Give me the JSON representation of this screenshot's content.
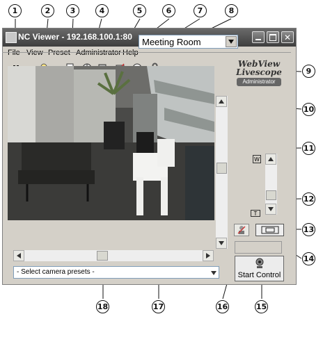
{
  "window": {
    "title": "NC Viewer - 192.168.100.1:80"
  },
  "menu": [
    "File",
    "View",
    "Preset",
    "Administrator",
    "Help"
  ],
  "toolbar": {
    "icons": [
      "pause-icon",
      "bulb-icon",
      "snapshot-icon",
      "move-icon",
      "save-image-icon",
      "camera-settings-icon",
      "target-icon",
      "wrench-icon"
    ],
    "preset_value": "Meeting Room"
  },
  "logo": {
    "line1": "WebView",
    "line2": "Livescope",
    "badge": "Administrator"
  },
  "controls": {
    "start_control_label": "Start Control",
    "camera_presets_placeholder": "- Select camera presets -",
    "zoom_max_label": "W",
    "zoom_min_label": "T"
  },
  "callouts": [
    "1",
    "2",
    "3",
    "4",
    "5",
    "6",
    "7",
    "8",
    "9",
    "10",
    "11",
    "12",
    "13",
    "14",
    "15",
    "16",
    "17",
    "18"
  ]
}
